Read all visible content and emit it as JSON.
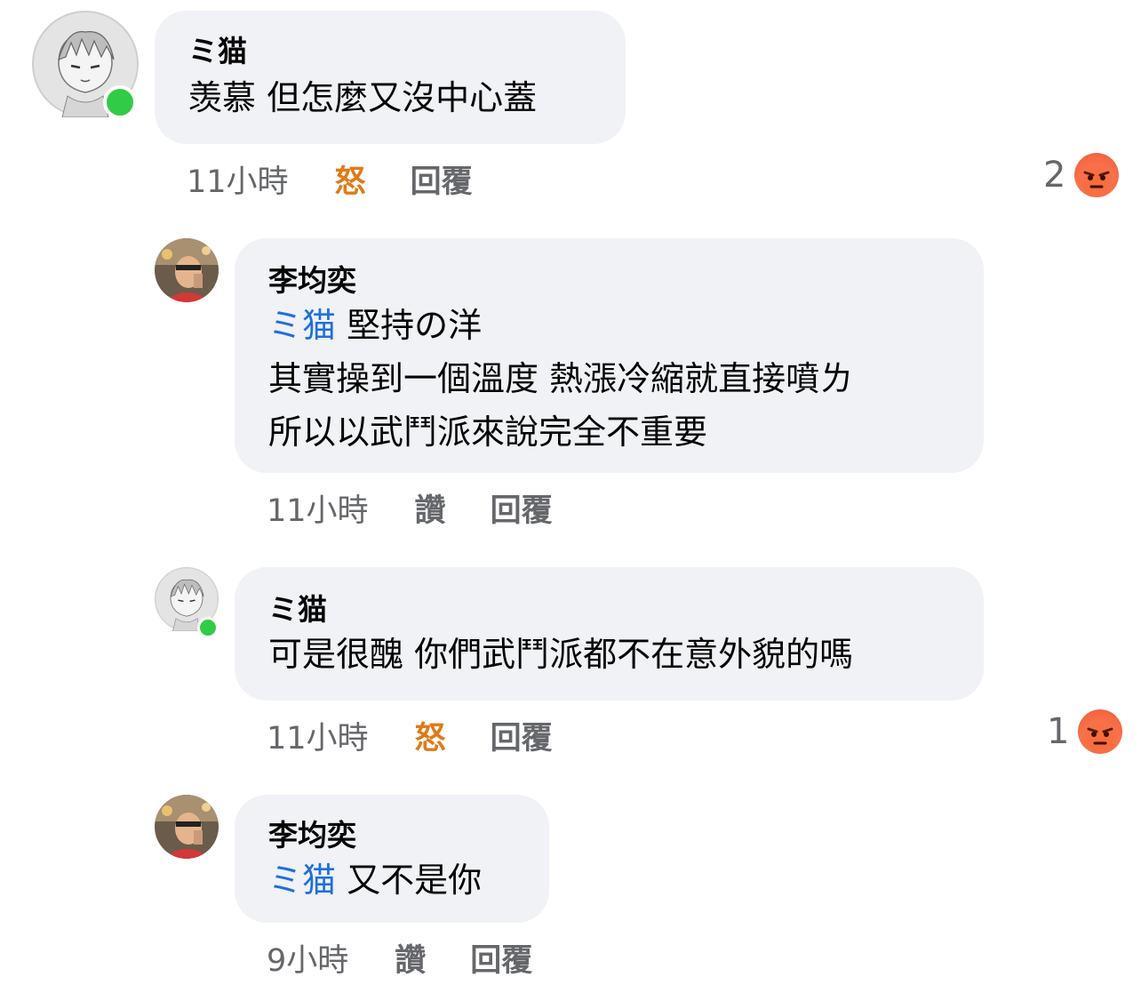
{
  "comments": [
    {
      "author": "ミ猫",
      "lines": [
        "羡慕 但怎麼又沒中心蓋"
      ],
      "time": "11小時",
      "action": "怒",
      "reply": "回覆",
      "reaction_count": "2",
      "reaction_icon": "angry-emoji-icon",
      "online": true
    },
    {
      "author": "李均奕",
      "mention": "ミ猫",
      "lines": [
        "堅持の洋",
        "其實操到一個溫度 熱漲冷縮就直接噴ㄌ",
        "所以以武鬥派來說完全不重要"
      ],
      "time": "11小時",
      "action": "讚",
      "reply": "回覆"
    },
    {
      "author": "ミ猫",
      "lines": [
        "可是很醜 你們武鬥派都不在意外貌的嗎"
      ],
      "time": "11小時",
      "action": "怒",
      "reply": "回覆",
      "reaction_count": "1",
      "reaction_icon": "angry-emoji-icon",
      "online": true
    },
    {
      "author": "李均奕",
      "mention": "ミ猫",
      "lines": [
        "又不是你"
      ],
      "time": "9小時",
      "action": "讚",
      "reply": "回覆"
    }
  ],
  "colors": {
    "bubble": "#f0f2f5",
    "mention": "#1f6fe0",
    "meta": "#65676b",
    "angry": "#e07a18",
    "online": "#31cc46"
  }
}
